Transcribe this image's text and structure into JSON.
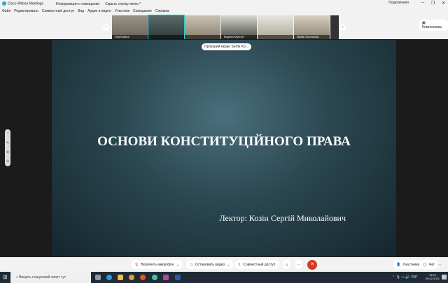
{
  "titlebar": {
    "app": "Cisco Webex Meetings",
    "info": "Информация о совещании",
    "hide": "Скрыть строку меню ^",
    "status": "Подключено"
  },
  "menu": [
    "Файл",
    "Редактировать",
    "Совместный доступ",
    "Вид",
    "Аудио и видео",
    "Участник",
    "Совещание",
    "Справка"
  ],
  "participants": [
    "Vira Kachur",
    "",
    "",
    "Bogdan Mysnyk",
    "",
    "Nikita Chernichuk"
  ],
  "layout_label": "Компоновка",
  "share_label": "Прозорий екран Serhii Ko...",
  "slide": {
    "title": "ОСНОВИ КОНСТИТУЦІЙНОГО ПРАВА",
    "lecturer": "Лектор: Козін Сергій Миколайович"
  },
  "toolbar": {
    "mic": "Включить микрофон",
    "video": "Остановить видео",
    "share": "Совместный доступ",
    "participants": "Участники",
    "chat": "Чат"
  },
  "taskbar": {
    "search": "Введіть пошуковий запит тут",
    "lang": "УКР",
    "time": "14:01",
    "date": "06.02.2021"
  }
}
